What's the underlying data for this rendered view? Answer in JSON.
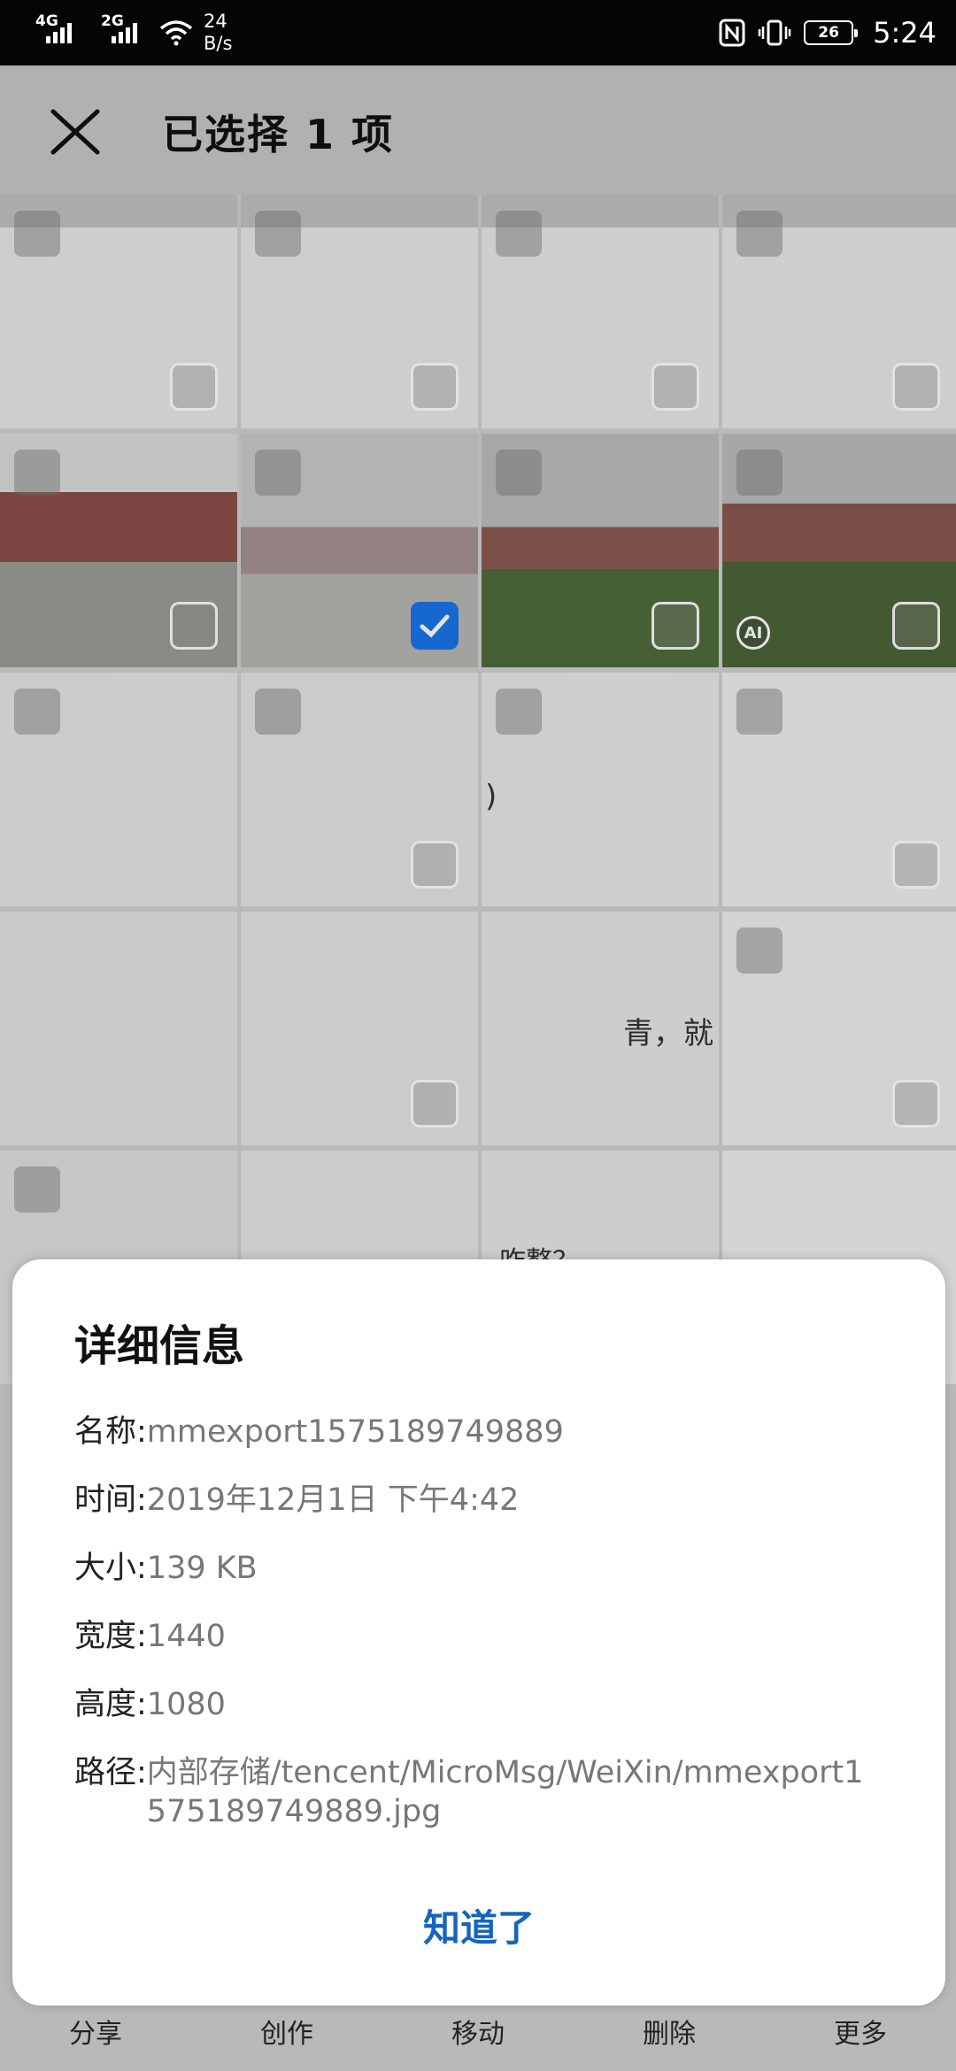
{
  "status_bar": {
    "net1": "4G",
    "net2": "2G",
    "speed_value": "24",
    "speed_unit": "B/s",
    "battery": "26",
    "time": "5:24",
    "icons": [
      "nfc-icon",
      "vibrate-icon",
      "battery-icon"
    ]
  },
  "header": {
    "title": "已选择 1 项",
    "close_icon": "close-icon"
  },
  "grid": {
    "row3_text": ")",
    "row4_text": "青，就",
    "row5_text": "咋整？",
    "selected_index": 5
  },
  "bottom_bar": {
    "items": [
      "分享",
      "创作",
      "移动",
      "删除",
      "更多"
    ]
  },
  "dialog": {
    "title": "详细信息",
    "rows": [
      {
        "label": "名称: ",
        "value": "mmexport1575189749889"
      },
      {
        "label": "时间: ",
        "value": "2019年12月1日 下午4:42"
      },
      {
        "label": "大小: ",
        "value": "139 KB"
      },
      {
        "label": "宽度: ",
        "value": "1440"
      },
      {
        "label": "高度: ",
        "value": "1080"
      },
      {
        "label": "路径: ",
        "value": "内部存储/tencent/MicroMsg/WeiXin/mmexport1575189749889.jpg"
      }
    ],
    "confirm_label": "知道了"
  },
  "colors": {
    "accent": "#1a73e8",
    "button_text": "#1565c0"
  }
}
